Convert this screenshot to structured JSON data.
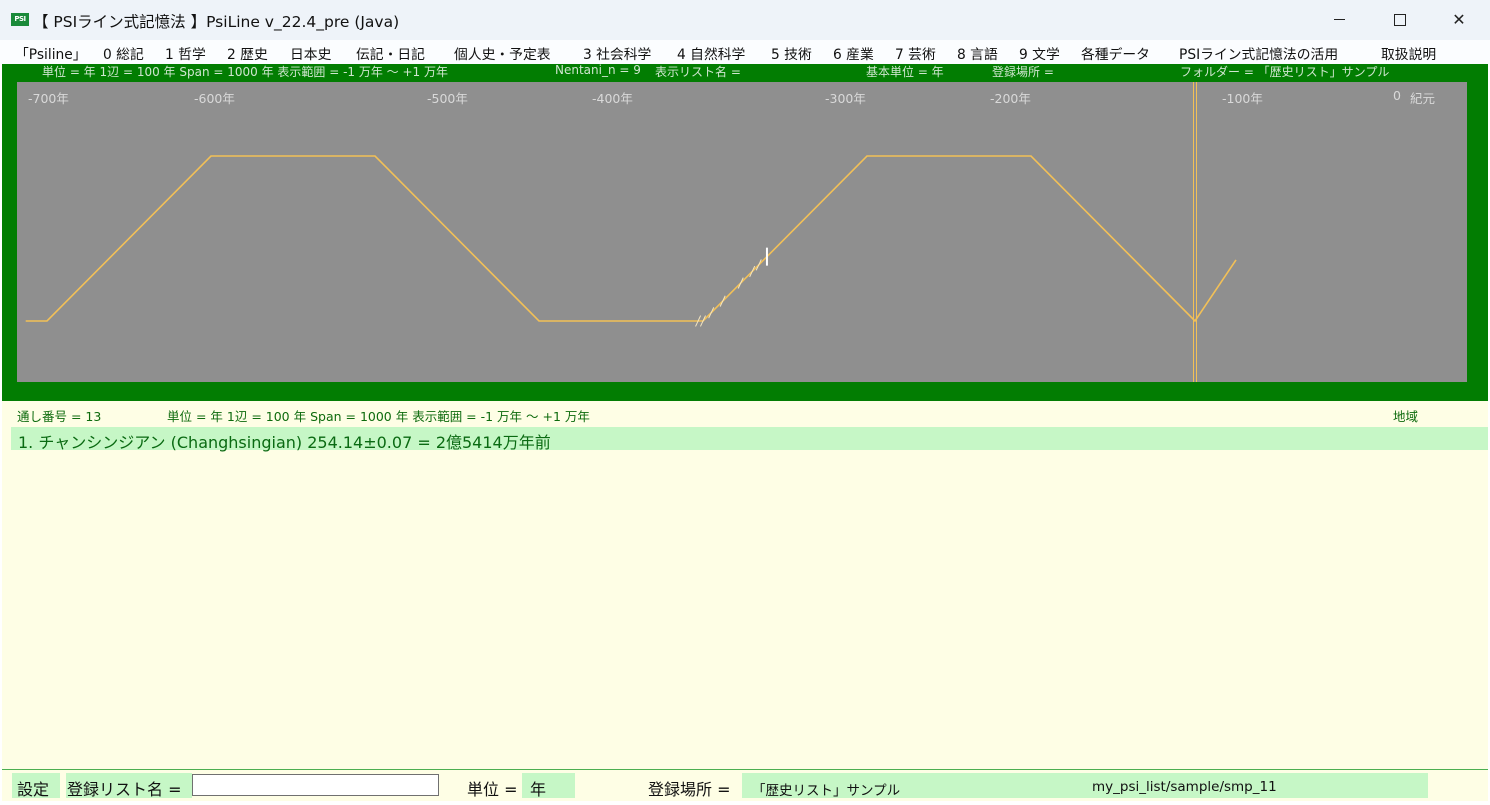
{
  "window": {
    "title": "【 PSIライン式記憶法 】PsiLine v_22.4_pre (Java)",
    "icon_text": "PSI",
    "controls": {
      "minimize": "minimize-icon",
      "maximize": "maximize-icon",
      "close": "✕"
    }
  },
  "menu": [
    "「Psiline」",
    "0 総記",
    "1 哲学",
    "2 歴史",
    "日本史",
    "伝記・日記",
    "個人史・予定表",
    "3 社会科学",
    "4 自然科学",
    "5 技術",
    "6 産業",
    "7 芸術",
    "8 言語",
    "9 文学",
    "各種データ",
    "PSIライン式記憶法の活用",
    "取扱説明"
  ],
  "top_info": {
    "unit": "単位 = 年  1辺 = 100 年  Span = 1000 年  表示範囲 = -1 万年 ～ +1 万年",
    "nentani": "Nentani_n = 9",
    "list_name": "表示リスト名 =",
    "base_unit": "基本単位 = 年",
    "location": "登録場所 =",
    "folder": "フォルダー = 「歴史リスト」サンプル"
  },
  "chart_data": {
    "type": "line",
    "x_unit": "年",
    "x_ticks": [
      "-700年",
      "-600年",
      "-500年",
      "-400年",
      "-300年",
      "-200年",
      "-100年",
      "0",
      "紀元"
    ],
    "x_range": [
      -713,
      -26
    ],
    "psi_line": {
      "side_years": 100,
      "points": [
        [
          -713,
          0
        ],
        [
          -700,
          0
        ],
        [
          -600,
          1
        ],
        [
          -500,
          1
        ],
        [
          -400,
          0
        ],
        [
          -300,
          0
        ],
        [
          -200,
          1
        ],
        [
          -100,
          1
        ],
        [
          0,
          0
        ],
        [
          25,
          0.37
        ]
      ]
    },
    "year_zero_marker": 0,
    "tick_marks": [
      {
        "year": -303,
        "highlight": false
      },
      {
        "year": -300,
        "highlight": false
      },
      {
        "year": -295,
        "highlight": false
      },
      {
        "year": -288,
        "highlight": false
      },
      {
        "year": -277,
        "highlight": false
      },
      {
        "year": -270,
        "highlight": false
      },
      {
        "year": -266,
        "highlight": false
      },
      {
        "year": -261,
        "highlight": true
      }
    ]
  },
  "status": {
    "serial": "通し番号 = 13",
    "unit_info": "単位 = 年  1辺 = 100 年  Span = 1000 年  表示範囲 = -1 万年 ～ +1 万年",
    "region_label": "地域"
  },
  "entries": [
    {
      "text": "1. チャンシンジアン (Changhsingian) 254.14±0.07 = 2億5414万年前"
    }
  ],
  "bottom": {
    "settings": "設定",
    "list_name_label": "登録リスト名 =",
    "list_name_value": "",
    "unit_label": "単位 =",
    "unit_value": "年",
    "location_label": "登録場所 =",
    "location_value": "「歴史リスト」サンプル",
    "path_value": "my_psi_list/sample/smp_11"
  },
  "colors": {
    "frame_green": "#027d02",
    "plot_bg": "#8f8f8f",
    "psi_line": "#f2c057",
    "entry_bg": "#c6f7c6"
  }
}
